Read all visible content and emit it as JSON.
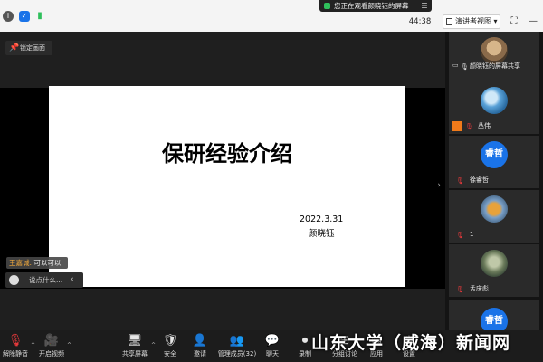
{
  "topbar": {
    "sharing_banner": "您正在观看颜晓钰的屏幕",
    "banner_menu_glyph": "☰",
    "timer": "44:38",
    "view_button": "演讲者视图",
    "view_caret": "▾",
    "info_glyph": "i",
    "shield_glyph": "✓",
    "signal_glyph": "▮"
  },
  "stage": {
    "lock_button": "锁定画面",
    "slide_title": "保研经验介绍",
    "slide_date": "2022.3.31",
    "slide_author": "颜晓钰",
    "side_arrow": "›",
    "chat_sender": "王嘉诚:",
    "chat_message": " 可以可以",
    "chat_placeholder": "说点什么...",
    "chat_chevron": "‹"
  },
  "participants": [
    {
      "name": "颜晓钰的屏幕共享"
    },
    {
      "name": "丛伟"
    },
    {
      "name": "徐睿哲",
      "avatar_text": "睿哲"
    },
    {
      "name": "1"
    },
    {
      "name": "孟庆彪"
    },
    {
      "name": "",
      "avatar_text": "睿哲"
    }
  ],
  "toolbar": {
    "unmute": "解除静音",
    "start_video": "开启视频",
    "share_screen": "共享屏幕",
    "security": "安全",
    "invite": "邀请",
    "manage_members": "管理成员(32)",
    "chat": "聊天",
    "record": "录制",
    "breakout": "分组讨论",
    "apps": "应用",
    "settings": "设置",
    "caret": "^"
  },
  "watermark": "山东大学（威海）新闻网",
  "colors": {
    "accent_blue": "#1a73e8",
    "mute_red": "#e5393b",
    "highlight_orange": "#f0a83c",
    "banner_green": "#2fbf5b"
  }
}
